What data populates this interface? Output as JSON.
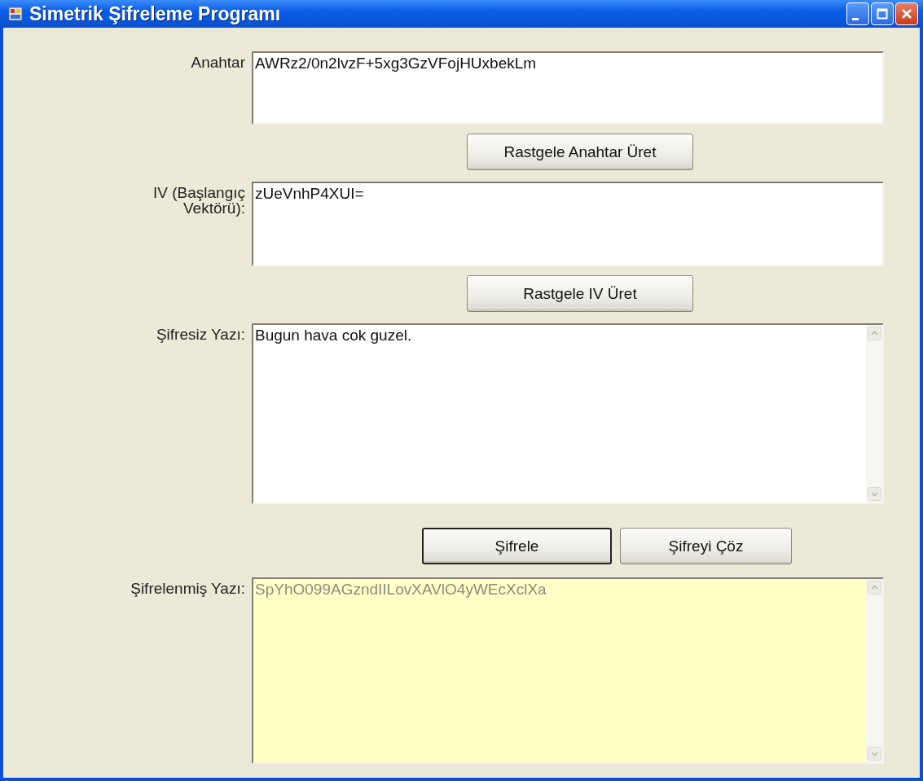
{
  "window": {
    "title": "Simetrik Şifreleme Programı"
  },
  "rows": [
    {
      "kind": "field",
      "label": "Anahtar",
      "value": "AWRz2/0n2lvzF+5xg3GzVFojHUxbekLm",
      "scrollbar": false,
      "readonly": false
    },
    {
      "kind": "buttons",
      "buttons": [
        {
          "label": "Rastgele Anahtar Üret",
          "default": false
        }
      ]
    },
    {
      "kind": "field",
      "label": "IV (Başlangıç Vektörü):",
      "value": "zUeVnhP4XUI=",
      "scrollbar": false,
      "readonly": false
    },
    {
      "kind": "buttons",
      "buttons": [
        {
          "label": "Rastgele IV Üret",
          "default": false
        }
      ]
    },
    {
      "kind": "field",
      "label": "Şifresiz Yazı:",
      "value": "Bugun hava cok guzel.",
      "scrollbar": true,
      "readonly": false
    },
    {
      "kind": "buttons",
      "buttons": [
        {
          "label": "Şifrele",
          "default": true
        },
        {
          "label": "Şifreyi Çöz",
          "default": false
        }
      ]
    },
    {
      "kind": "field",
      "label": "Şifrelenmiş Yazı:",
      "value": "SpYhO099AGzndIILovXAVlO4yWEcXclXa",
      "scrollbar": true,
      "readonly": true
    }
  ]
}
